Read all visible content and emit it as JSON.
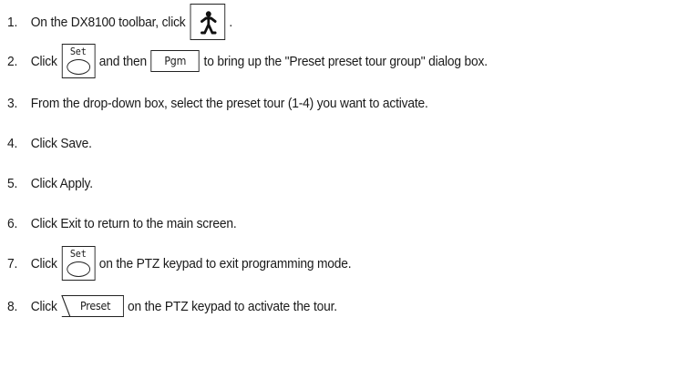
{
  "steps": [
    {
      "number": "1.",
      "text_before": "On the DX8100 toolbar, click",
      "key": "person-icon",
      "text_after": "."
    },
    {
      "number": "2.",
      "text_before": "Click",
      "key1_label": "Set",
      "text_middle": "and then",
      "key2_label": "Pgm",
      "text_after": "to bring up the \"Preset preset tour group\" dialog box."
    },
    {
      "number": "3.",
      "text": "From the drop-down box, select the preset tour (1-4) you want to activate."
    },
    {
      "number": "4.",
      "text": "Click Save."
    },
    {
      "number": "5.",
      "text": "Click Apply."
    },
    {
      "number": "6.",
      "text": "Click Exit to return to the main screen."
    },
    {
      "number": "7.",
      "text_before": "Click",
      "key_label": "Set",
      "text_after": "on the PTZ keypad to exit programming mode."
    },
    {
      "number": "8.",
      "text_before": "Click",
      "key_label": "Preset",
      "text_after": "on the PTZ keypad to activate the tour."
    }
  ]
}
